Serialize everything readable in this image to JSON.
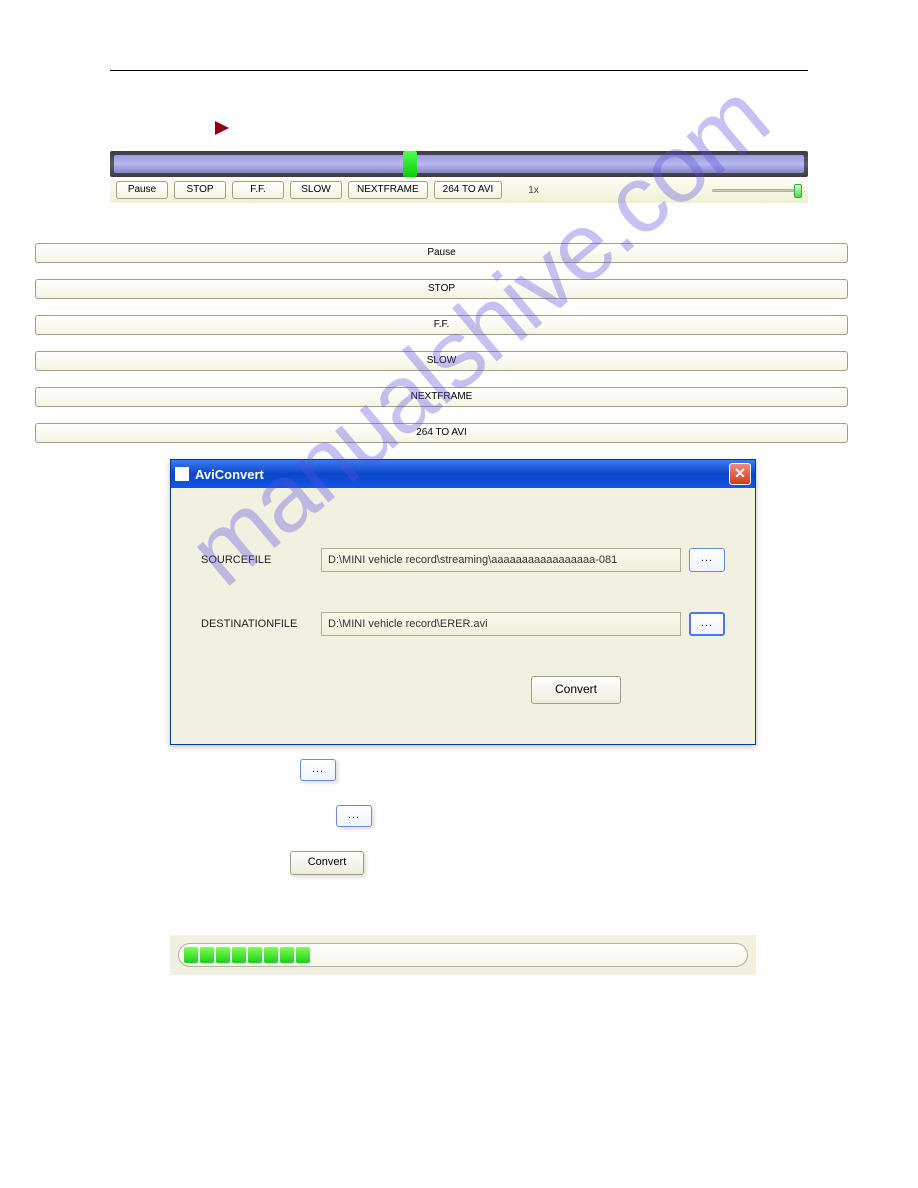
{
  "controls": {
    "pause": "Pause",
    "stop": "STOP",
    "ff": "F.F.",
    "slow": "SLOW",
    "nextframe": "NEXTFRAME",
    "toavi": "264 TO AVI",
    "speed": "1x"
  },
  "list": {
    "pause": "Pause",
    "stop": "STOP",
    "ff": "F.F.",
    "slow": "SLOW",
    "nextframe": "NEXTFRAME",
    "toavi": "264 TO AVI"
  },
  "dialog": {
    "title": "AviConvert",
    "close": "✕",
    "source_label": "SOURCEFILE",
    "source_value": "D:\\MINI vehicle record\\streaming\\aaaaaaaaaaaaaaaaa-081",
    "dest_label": "DESTINATIONFILE",
    "dest_value": "D:\\MINI vehicle record\\ERER.avi",
    "browse": "...",
    "convert": "Convert"
  },
  "inline": {
    "browse": "...",
    "convert": "Convert"
  },
  "watermark": "manualshive.com"
}
